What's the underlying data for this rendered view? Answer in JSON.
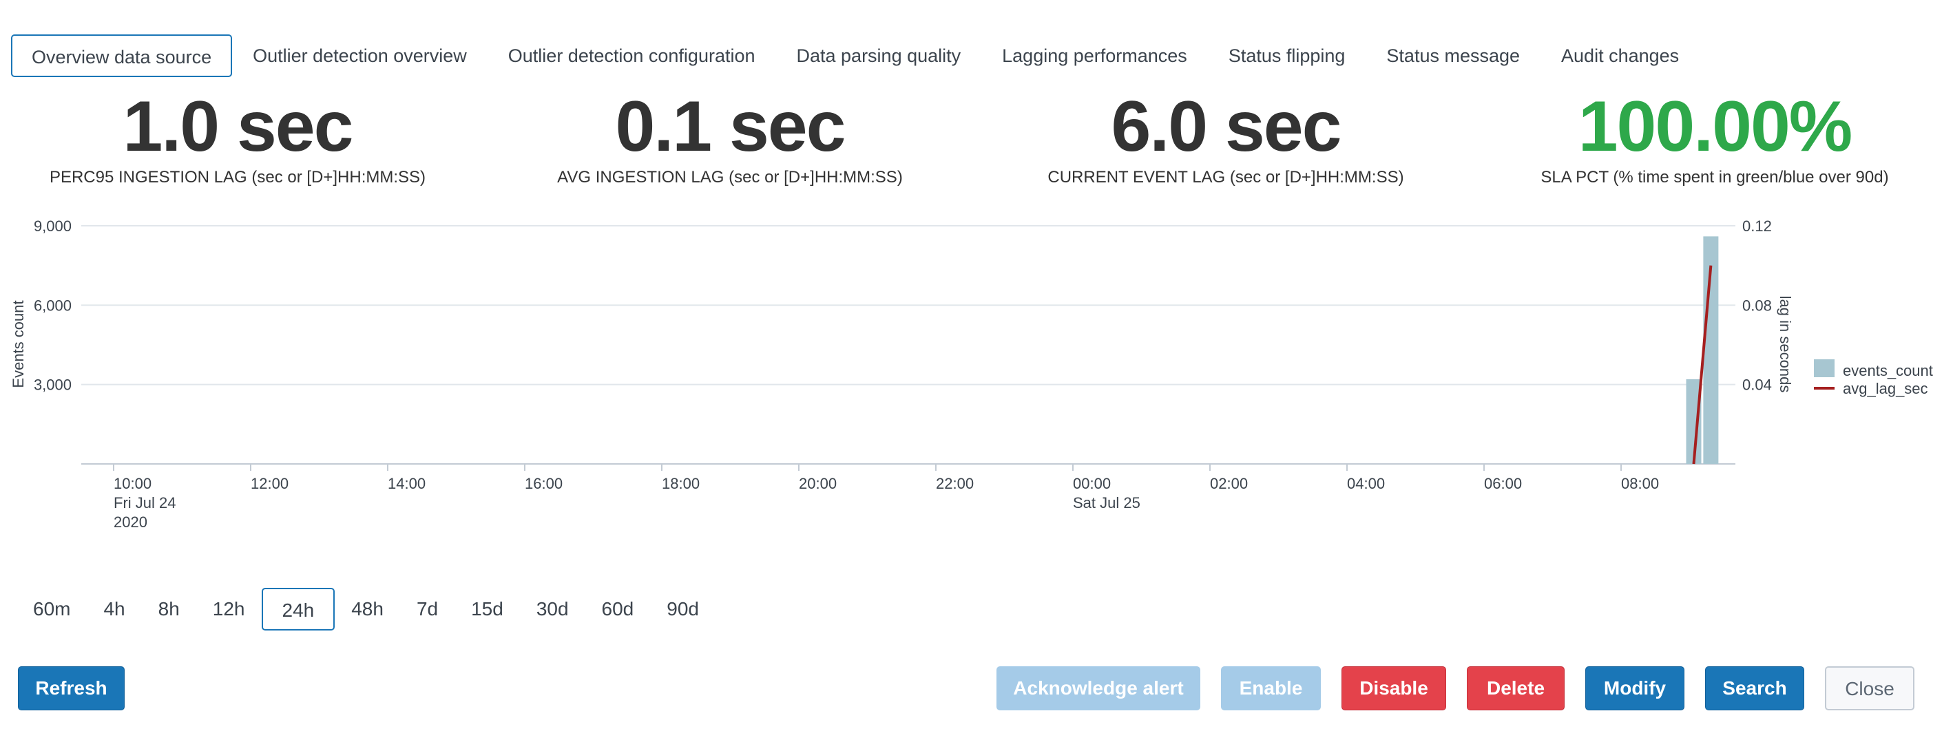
{
  "tabs": [
    {
      "label": "Overview data source",
      "active": true
    },
    {
      "label": "Outlier detection overview"
    },
    {
      "label": "Outlier detection configuration"
    },
    {
      "label": "Data parsing quality"
    },
    {
      "label": "Lagging performances"
    },
    {
      "label": "Status flipping"
    },
    {
      "label": "Status message"
    },
    {
      "label": "Audit changes"
    }
  ],
  "kpis": [
    {
      "value": "1.0 sec",
      "label": "PERC95 INGESTION LAG (sec or [D+]HH:MM:SS)"
    },
    {
      "value": "0.1 sec",
      "label": "AVG INGESTION LAG (sec or [D+]HH:MM:SS)"
    },
    {
      "value": "6.0 sec",
      "label": "CURRENT EVENT LAG (sec or [D+]HH:MM:SS)"
    },
    {
      "value": "100.00%",
      "label": "SLA PCT (% time spent in green/blue over 90d)",
      "color": "#2ea84a"
    }
  ],
  "chart_data": {
    "type": "bar+line",
    "y_left_label": "Events count",
    "y_right_label": "lag in seconds",
    "y_left_ticks": [
      "9,000",
      "6,000",
      "3,000"
    ],
    "y_left_tick_values": [
      9000,
      6000,
      3000
    ],
    "y_right_ticks": [
      "0.12",
      "0.08",
      "0.04"
    ],
    "y_right_tick_values": [
      0.12,
      0.08,
      0.04
    ],
    "ylim_left": [
      0,
      9000
    ],
    "ylim_right": [
      0,
      0.12
    ],
    "x_ticks": [
      {
        "h": 0,
        "lines": [
          "10:00",
          "Fri Jul 24",
          "2020"
        ]
      },
      {
        "h": 2,
        "lines": [
          "12:00"
        ]
      },
      {
        "h": 4,
        "lines": [
          "14:00"
        ]
      },
      {
        "h": 6,
        "lines": [
          "16:00"
        ]
      },
      {
        "h": 8,
        "lines": [
          "18:00"
        ]
      },
      {
        "h": 10,
        "lines": [
          "20:00"
        ]
      },
      {
        "h": 12,
        "lines": [
          "22:00"
        ]
      },
      {
        "h": 14,
        "lines": [
          "00:00",
          "Sat Jul 25"
        ]
      },
      {
        "h": 16,
        "lines": [
          "02:00"
        ]
      },
      {
        "h": 18,
        "lines": [
          "04:00"
        ]
      },
      {
        "h": 20,
        "lines": [
          "06:00"
        ]
      },
      {
        "h": 22,
        "lines": [
          "08:00"
        ]
      }
    ],
    "series": [
      {
        "name": "events_count",
        "kind": "bar",
        "color": "#a7c6d1",
        "points": [
          {
            "x": "09:00 Sat Jul 25",
            "h": 23.0,
            "y": 3200
          },
          {
            "x": "09:15 Sat Jul 25",
            "h": 23.25,
            "y": 8600
          }
        ]
      },
      {
        "name": "avg_lag_sec",
        "kind": "line",
        "color": "#a51f1f",
        "points": [
          {
            "x": "09:00 Sat Jul 25",
            "h": 23.0,
            "y": 0.0
          },
          {
            "x": "09:15 Sat Jul 25",
            "h": 23.25,
            "y": 0.1
          }
        ]
      }
    ],
    "legend_position": "right",
    "grid": true
  },
  "time_ranges": [
    {
      "label": "60m"
    },
    {
      "label": "4h"
    },
    {
      "label": "8h"
    },
    {
      "label": "12h"
    },
    {
      "label": "24h",
      "active": true
    },
    {
      "label": "48h"
    },
    {
      "label": "7d"
    },
    {
      "label": "15d"
    },
    {
      "label": "30d"
    },
    {
      "label": "60d"
    },
    {
      "label": "90d"
    }
  ],
  "buttons": {
    "refresh": "Refresh",
    "acknowledge": "Acknowledge alert",
    "enable": "Enable",
    "disable": "Disable",
    "delete": "Delete",
    "modify": "Modify",
    "search": "Search",
    "close": "Close"
  },
  "colors": {
    "accent": "#1a76b7",
    "danger": "#e4424b",
    "success": "#2ea84a",
    "bar": "#a7c6d1",
    "line": "#a51f1f"
  }
}
